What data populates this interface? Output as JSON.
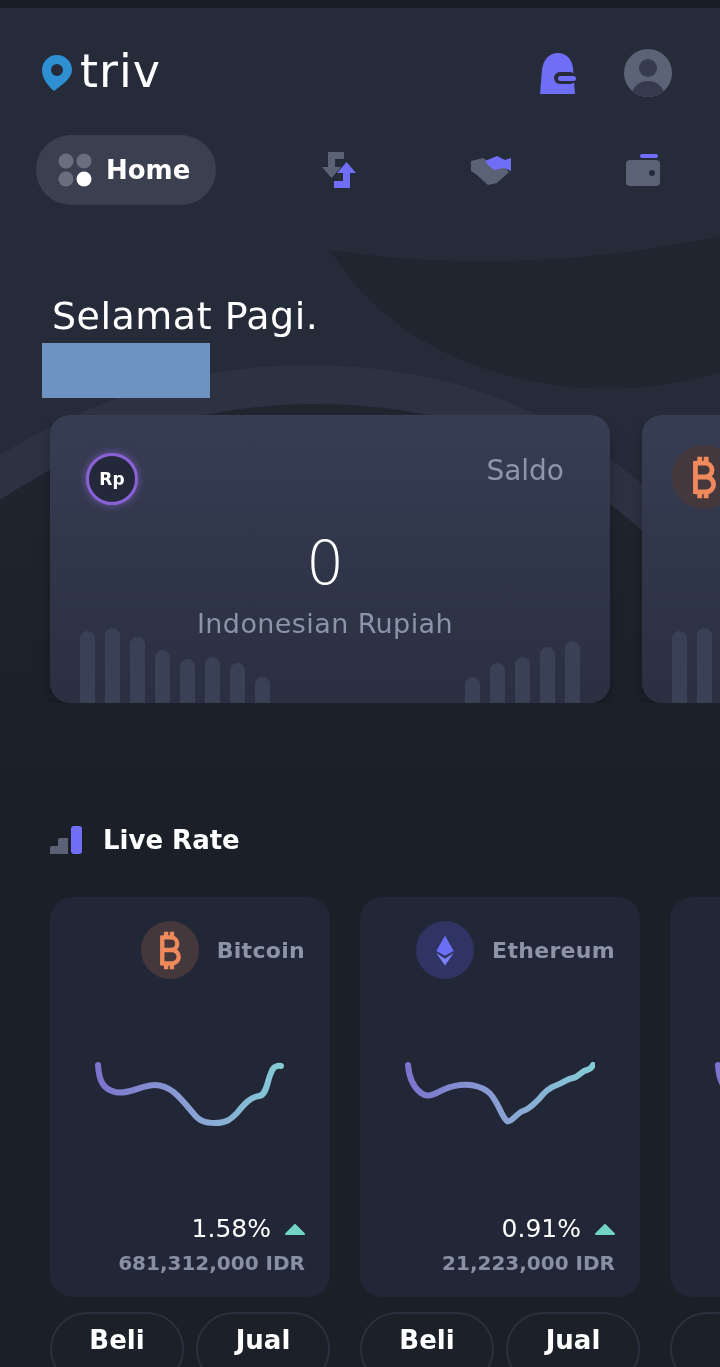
{
  "header": {
    "logo_text": "triv"
  },
  "nav_tabs": [
    {
      "kind": "home",
      "label": "Home",
      "selected": true
    },
    {
      "kind": "exchange",
      "selected": false
    },
    {
      "kind": "trade",
      "selected": false
    },
    {
      "kind": "wallet",
      "selected": false
    }
  ],
  "greeting": "Selamat Pagi.",
  "balance_cards": [
    {
      "kind": "rupiah",
      "currency_code": "Rp",
      "label": "Saldo",
      "amount": "0",
      "currency_name": "Indonesian Rupiah"
    },
    {
      "kind": "bitcoin"
    }
  ],
  "live_rate": {
    "title": "Live Rate",
    "cards": [
      {
        "kind": "bitcoin",
        "name": "Bitcoin",
        "change": "1.58%",
        "rising": true,
        "price": "681,312,000 IDR",
        "buttons": [
          "Beli",
          "Jual"
        ]
      },
      {
        "kind": "ethereum",
        "name": "Ethereum",
        "change": "0.91%",
        "rising": true,
        "price": "21,223,000 IDR",
        "buttons": [
          "Beli",
          "Jual"
        ]
      },
      {
        "kind": "unknown"
      }
    ]
  }
}
